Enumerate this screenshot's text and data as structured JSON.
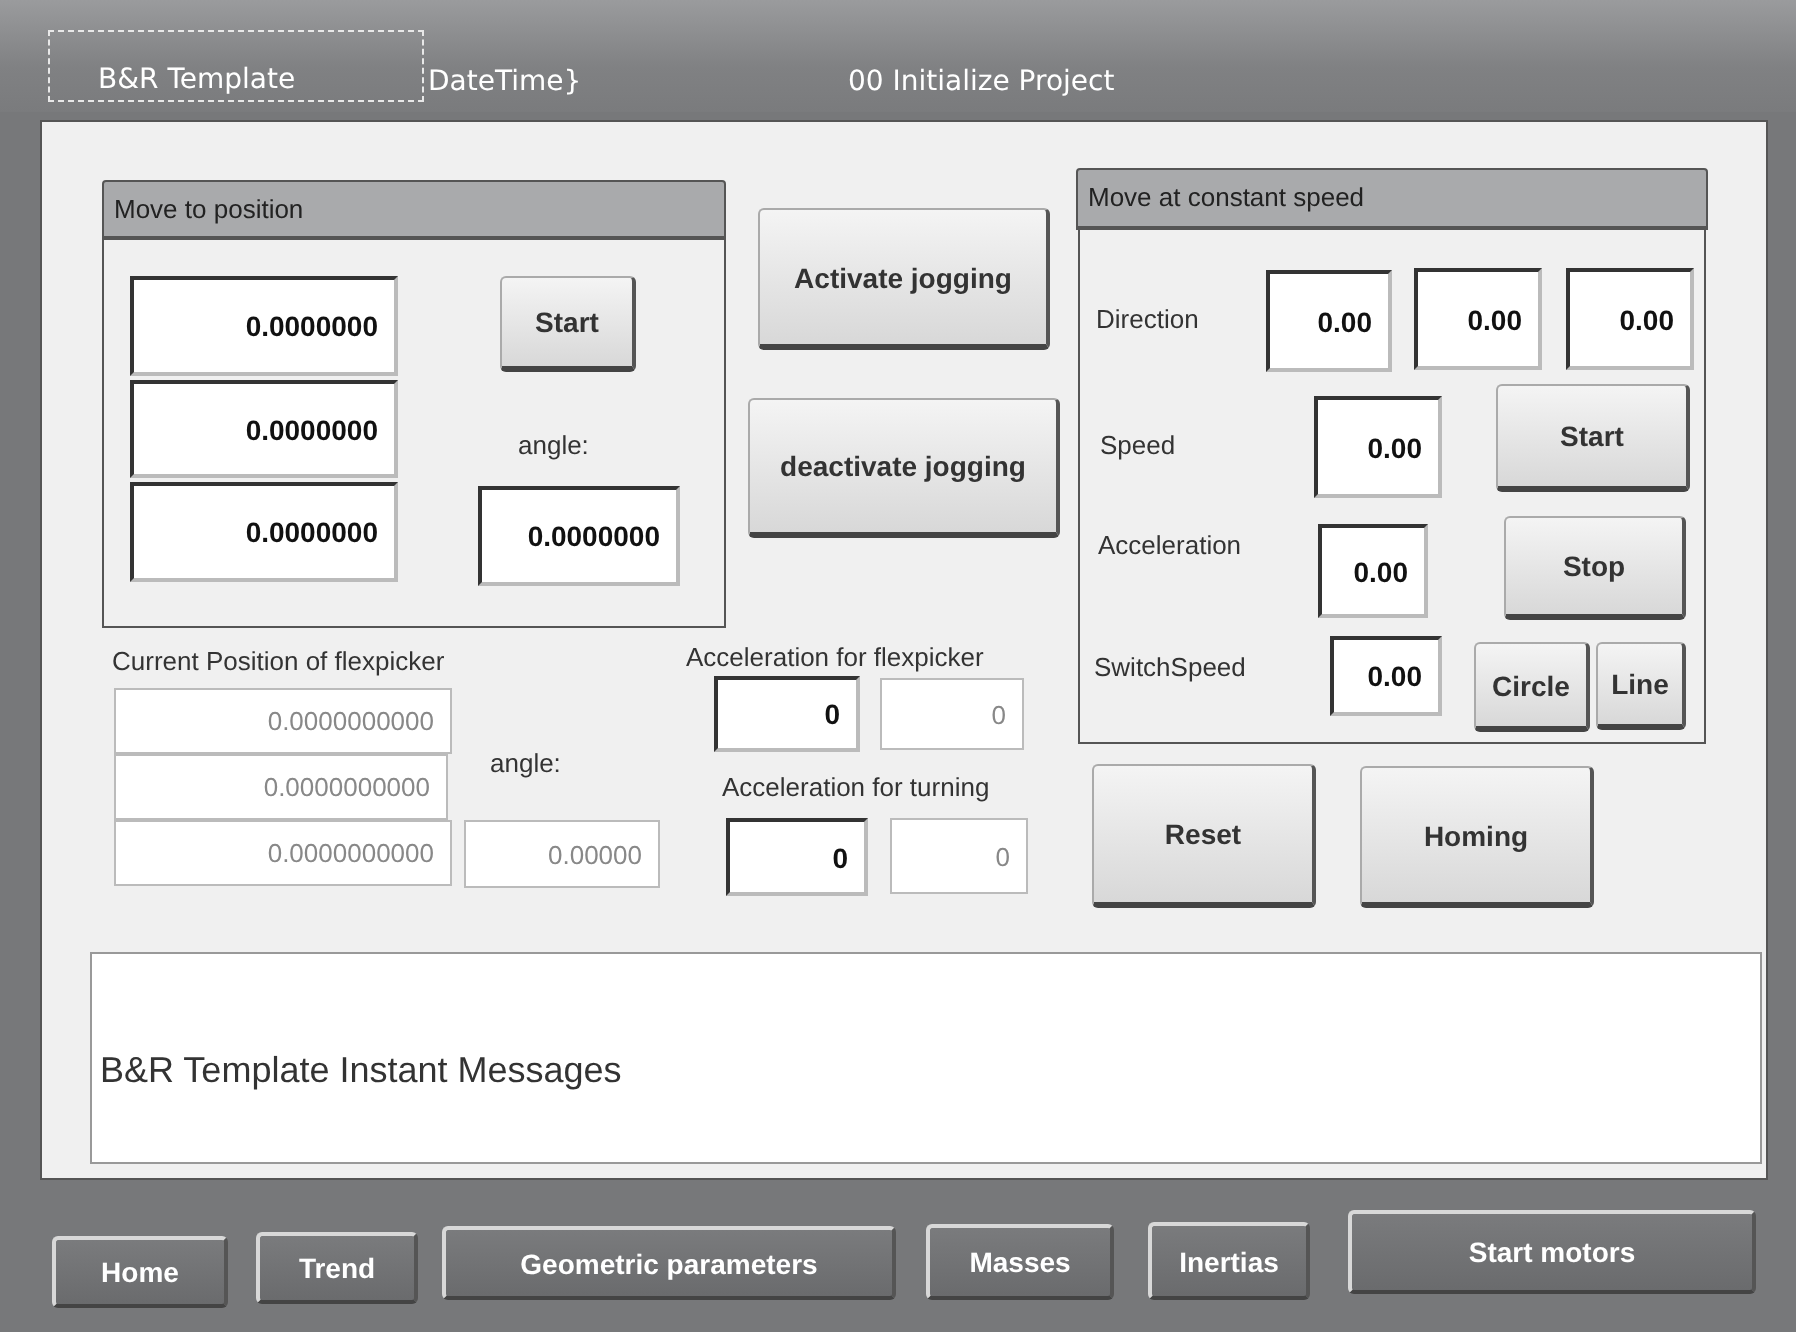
{
  "header": {
    "template": "B&R Template",
    "datetime": "DateTime}",
    "page_title": "00 Initialize Project"
  },
  "move_to_position": {
    "title": "Move to position",
    "fields": [
      {
        "value": "0.0000000",
        "kind": "input"
      },
      {
        "value": "0.0000000",
        "kind": "input"
      },
      {
        "value": "0.0000000",
        "kind": "input"
      }
    ],
    "start": "Start",
    "angle_label": "angle:",
    "angle": {
      "value": "0.0000000",
      "kind": "input"
    }
  },
  "jogging": [
    "Activate jogging",
    "deactivate jogging"
  ],
  "constant_speed": {
    "title": "Move at constant speed",
    "direction_label": "Direction",
    "direction": [
      {
        "value": "0.00",
        "kind": "input"
      },
      {
        "value": "0.00",
        "kind": "input"
      },
      {
        "value": "0.00",
        "kind": "input"
      }
    ],
    "speed_label": "Speed",
    "speed": {
      "value": "0.00",
      "kind": "input"
    },
    "start": "Start",
    "acceleration_label": "Acceleration",
    "acceleration": {
      "value": "0.00",
      "kind": "input"
    },
    "stop": "Stop",
    "switchspeed_label": "SwitchSpeed",
    "switchspeed": {
      "value": "0.00",
      "kind": "input"
    },
    "circle": "Circle",
    "line": "Line"
  },
  "current_position": {
    "label": "Current Position of flexpicker",
    "fields": [
      {
        "value": "0.0000000000",
        "kind": "display"
      },
      {
        "value": "0.0000000000",
        "kind": "display"
      },
      {
        "value": "0.0000000000",
        "kind": "display"
      }
    ],
    "angle_label": "angle:",
    "angle": {
      "value": "0.00000",
      "kind": "display"
    }
  },
  "acceleration_flexpicker": {
    "label": "Acceleration for flexpicker",
    "fields": [
      {
        "value": "0",
        "kind": "input"
      },
      {
        "value": "0",
        "kind": "display"
      }
    ]
  },
  "acceleration_turning": {
    "label": "Acceleration for turning",
    "fields": [
      {
        "value": "0",
        "kind": "input"
      },
      {
        "value": "0",
        "kind": "display"
      }
    ]
  },
  "actions": [
    "Reset",
    "Homing"
  ],
  "messages": "B&R Template Instant Messages",
  "nav": [
    "Home",
    "Trend",
    "Geometric parameters",
    "Masses",
    "Inertias",
    "Start motors"
  ]
}
